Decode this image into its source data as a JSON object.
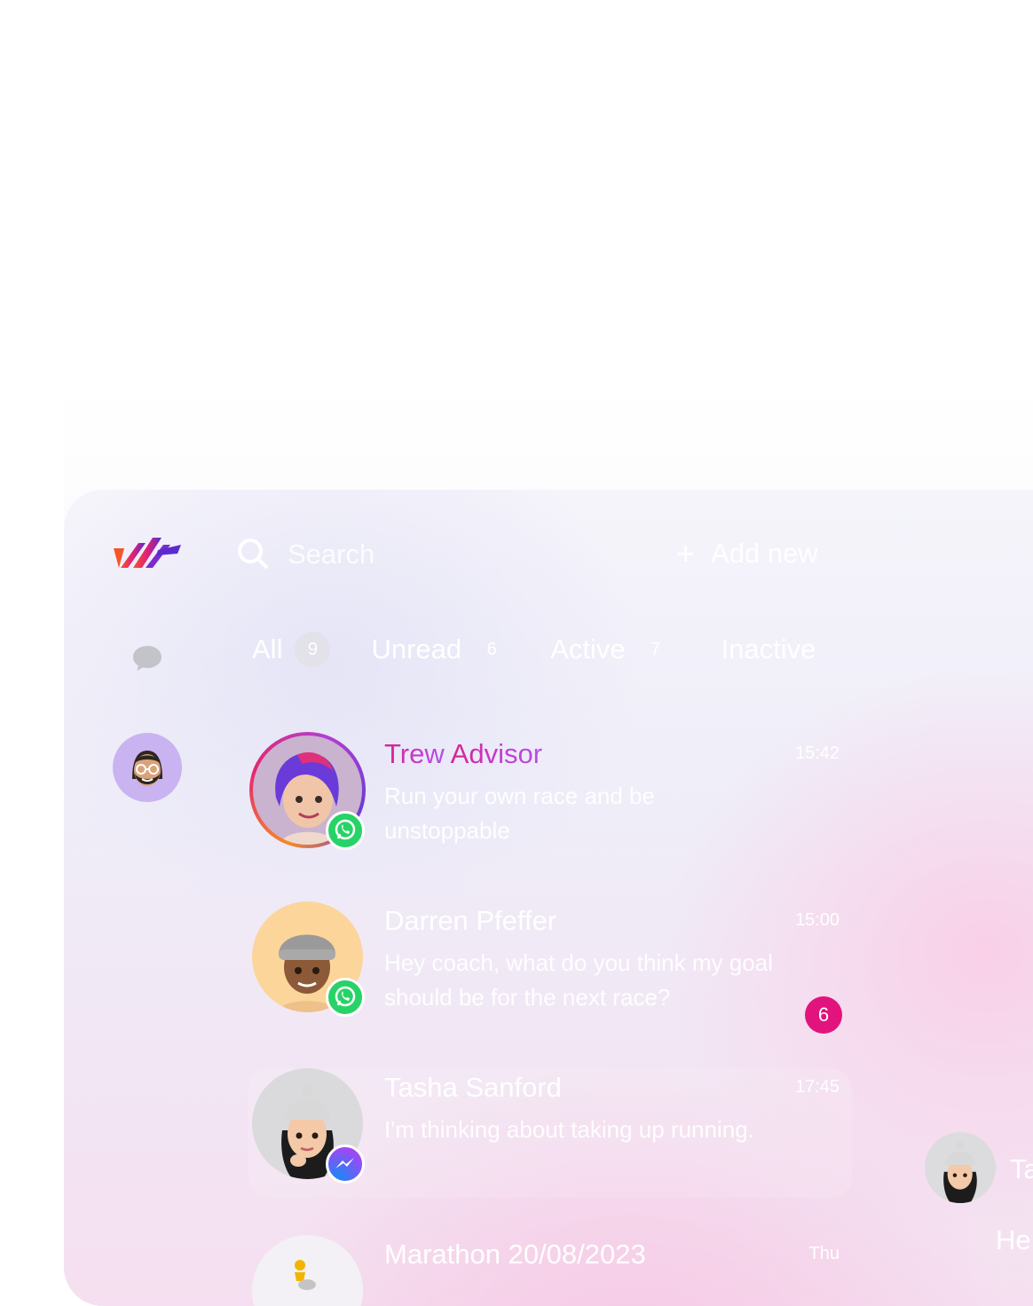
{
  "app": {
    "search": {
      "placeholder": "Search"
    },
    "add_new_label": "Add new",
    "add_new_icon": "plus-icon",
    "nav": [
      {
        "icon": "chat-bubble-icon"
      },
      {
        "icon": "user-avatar"
      }
    ],
    "tabs": [
      {
        "label": "All",
        "count": "9"
      },
      {
        "label": "Unread",
        "count": "6"
      },
      {
        "label": "Active",
        "count": "7"
      },
      {
        "label": "Inactive"
      }
    ],
    "conversations": [
      {
        "name_first": "Trew",
        "name_rest": " Advisor",
        "time": "15:42",
        "preview": "Run your own race and be unstoppable",
        "platform": "whatsapp"
      },
      {
        "name": "Darren Pfeffer",
        "time": "15:00",
        "preview": "Hey coach, what do you think my goal should be for the next race?",
        "unread": "6",
        "platform": "whatsapp"
      },
      {
        "name": "Tasha Sanford",
        "time": "17:45",
        "preview": "I'm thinking about taking up running.",
        "platform": "messenger"
      },
      {
        "name": "Marathon 20/08/2023",
        "time": "Thu",
        "platform": "group"
      }
    ],
    "chat_panel": {
      "name": "Ta",
      "message": "He"
    }
  },
  "colors": {
    "accent_pink": "#e3137e",
    "name_gradient_start": "#d8218a",
    "name_gradient_end": "#b550e6",
    "whatsapp_green": "#27d366",
    "messenger_blue": "#1c86f7",
    "avatar_purple": "#c9b3f1"
  }
}
